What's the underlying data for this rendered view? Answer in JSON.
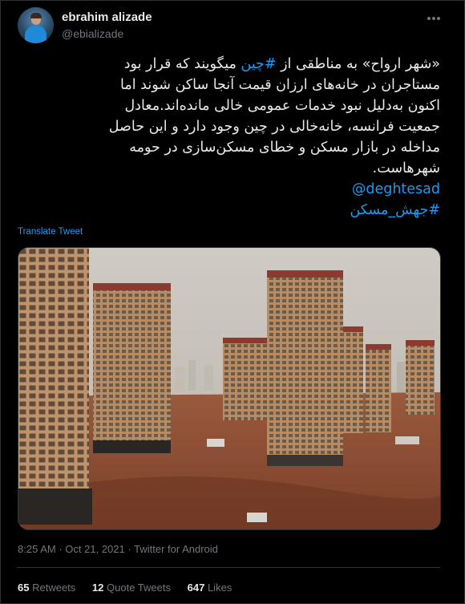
{
  "author": {
    "name": "ebrahim alizade",
    "handle": "@ebializade"
  },
  "tweet": {
    "line1_a": "«شهر ارواح» به مناطقی از ",
    "line1_hashtag": "#چین",
    "line1_b": " میگویند که قرار بود",
    "line2": "مستاجران در خانه‌های ارزان قیمت آنجا ساکن شوند اما",
    "line3": "اکنون به‌دلیل نبود خدمات عمومی خالی مانده‌اند.معادل",
    "line4": "جمعیت فرانسه، خانه‌خالی در چین وجود دارد و این حاصل",
    "line5": "مداخله در بازار مسکن و خطای مسکن‌سازی در حومه",
    "line6": "شهرهاست.",
    "mention": "@deghtesad",
    "hashtag2": "#جهش_مسکن"
  },
  "translate_label": "Translate Tweet",
  "meta": {
    "time": "8:25 AM",
    "date": "Oct 21, 2021",
    "separator": "·",
    "source": "Twitter for Android"
  },
  "stats": {
    "retweets_count": "65",
    "retweets_label": "Retweets",
    "quotes_count": "12",
    "quotes_label": "Quote Tweets",
    "likes_count": "647",
    "likes_label": "Likes"
  },
  "colors": {
    "background": "#000000",
    "link": "#1d9bf0",
    "text": "#e7e9ea",
    "muted": "#71767b"
  },
  "icons": {
    "more": "more-horizontal-icon"
  }
}
